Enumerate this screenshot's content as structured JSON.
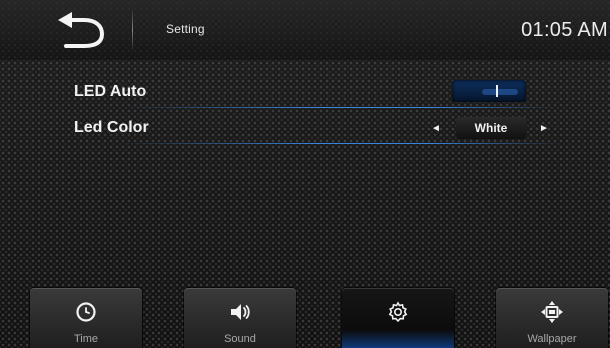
{
  "header": {
    "title": "Setting",
    "clock": "01:05 AM"
  },
  "settings": {
    "led_auto": {
      "label": "LED Auto",
      "toggle_state": "on"
    },
    "led_color": {
      "label": "Led Color",
      "value": "White",
      "prev_arrow": "◄",
      "next_arrow": "►"
    }
  },
  "bottom_nav": {
    "items": [
      {
        "label": "Time",
        "icon": "clock-icon",
        "active": false
      },
      {
        "label": "Sound",
        "icon": "speaker-icon",
        "active": false
      },
      {
        "label": "",
        "icon": "gear-icon",
        "active": true
      },
      {
        "label": "Wallpaper",
        "icon": "wallpaper-icon",
        "active": false
      }
    ]
  },
  "colors": {
    "accent": "#2f7bff",
    "divider_glow": "#3c96ff",
    "toggle_track": "#0e2f5e"
  }
}
